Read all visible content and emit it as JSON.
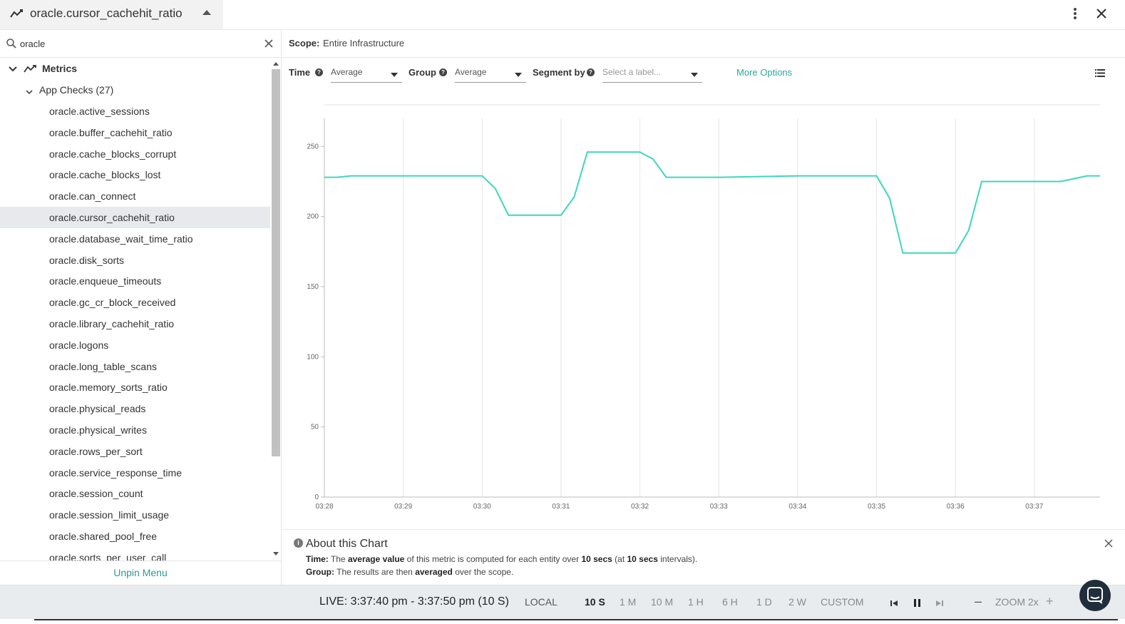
{
  "header": {
    "title": "oracle.cursor_cachehit_ratio"
  },
  "sidebar": {
    "search": {
      "value": "oracle"
    },
    "metrics_label": "Metrics",
    "app_checks_label": "App Checks (27)",
    "items": [
      "oracle.active_sessions",
      "oracle.buffer_cachehit_ratio",
      "oracle.cache_blocks_corrupt",
      "oracle.cache_blocks_lost",
      "oracle.can_connect",
      "oracle.cursor_cachehit_ratio",
      "oracle.database_wait_time_ratio",
      "oracle.disk_sorts",
      "oracle.enqueue_timeouts",
      "oracle.gc_cr_block_received",
      "oracle.library_cachehit_ratio",
      "oracle.logons",
      "oracle.long_table_scans",
      "oracle.memory_sorts_ratio",
      "oracle.physical_reads",
      "oracle.physical_writes",
      "oracle.rows_per_sort",
      "oracle.service_response_time",
      "oracle.session_count",
      "oracle.session_limit_usage",
      "oracle.shared_pool_free",
      "oracle.sorts_per_user_call"
    ],
    "selected_index": 5,
    "unpin_label": "Unpin Menu"
  },
  "scope": {
    "label": "Scope:",
    "value": "Entire Infrastructure"
  },
  "controls": {
    "time_label": "Time",
    "time_value": "Average",
    "group_label": "Group",
    "group_value": "Average",
    "segment_label": "Segment by",
    "segment_placeholder": "Select a label...",
    "more_options": "More Options"
  },
  "chart_data": {
    "type": "line",
    "x_ticks": [
      "03:28",
      "03:29",
      "03:30",
      "03:31",
      "03:32",
      "03:33",
      "03:34",
      "03:35",
      "03:36",
      "03:37"
    ],
    "y_ticks": [
      0,
      50,
      100,
      150,
      200,
      250
    ],
    "ylim": [
      0,
      270
    ],
    "xlim": [
      0,
      590
    ],
    "grid": "vertical",
    "color": "#3dd6bf",
    "x": [
      0,
      10,
      20,
      60,
      120,
      130,
      140,
      180,
      190,
      200,
      240,
      250,
      260,
      270,
      300,
      360,
      420,
      430,
      440,
      480,
      490,
      500,
      560,
      570,
      580,
      590
    ],
    "values": [
      228,
      228,
      229,
      229,
      229,
      220,
      201,
      201,
      214,
      246,
      246,
      241,
      228,
      228,
      228,
      229,
      229,
      213,
      174,
      174,
      190,
      225,
      225,
      227,
      229,
      229
    ]
  },
  "about": {
    "title": "About this Chart",
    "time_key": "Time:",
    "time_pre": "The ",
    "time_b1": "average value",
    "time_mid": " of this metric is computed for each entity over ",
    "time_b2": "10 secs",
    "time_mid2": " (at ",
    "time_b3": "10 secs",
    "time_post": " intervals).",
    "group_key": "Group:",
    "group_pre": "The results are then ",
    "group_b1": "averaged",
    "group_post": " over the scope."
  },
  "bottom": {
    "live": "LIVE: 3:37:40 pm - 3:37:50 pm (10 S)",
    "tz": "LOCAL",
    "ranges": [
      "10 S",
      "1 M",
      "10 M",
      "1 H",
      "6 H",
      "1 D",
      "2 W",
      "CUSTOM"
    ],
    "active_range": "10 S",
    "zoom_minus": "–",
    "zoom_label": "ZOOM 2x",
    "zoom_plus": "+"
  },
  "colors": {
    "accent": "#2aa89a",
    "line": "#3dd6bf",
    "selected_row": "#e7e9ec",
    "bottom_bar": "#e9ecef"
  }
}
